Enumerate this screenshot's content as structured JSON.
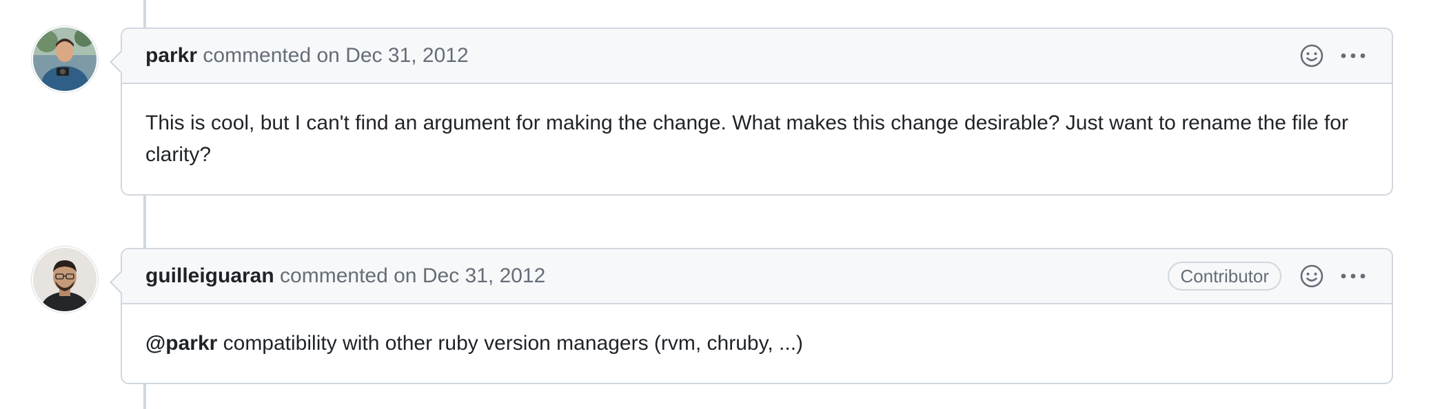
{
  "comments": [
    {
      "author": "parkr",
      "action": "commented on",
      "date": "Dec 31, 2012",
      "badge": null,
      "body": "This is cool, but I can't find an argument for making the change. What makes this change desirable? Just want to rename the file for clarity?",
      "mention": null,
      "icons": [
        "smiley-icon",
        "kebab-horizontal-icon"
      ]
    },
    {
      "author": "guilleiguaran",
      "action": "commented on",
      "date": "Dec 31, 2012",
      "badge": "Contributor",
      "mention": "@parkr",
      "body": " compatibility with other ruby version managers (rvm, chruby, ...)",
      "icons": [
        "smiley-icon",
        "kebab-horizontal-icon"
      ]
    }
  ],
  "colors": {
    "border": "#d0d7de",
    "header_bg": "#f6f8fa",
    "muted_text": "#656d76",
    "text": "#1f2328"
  }
}
